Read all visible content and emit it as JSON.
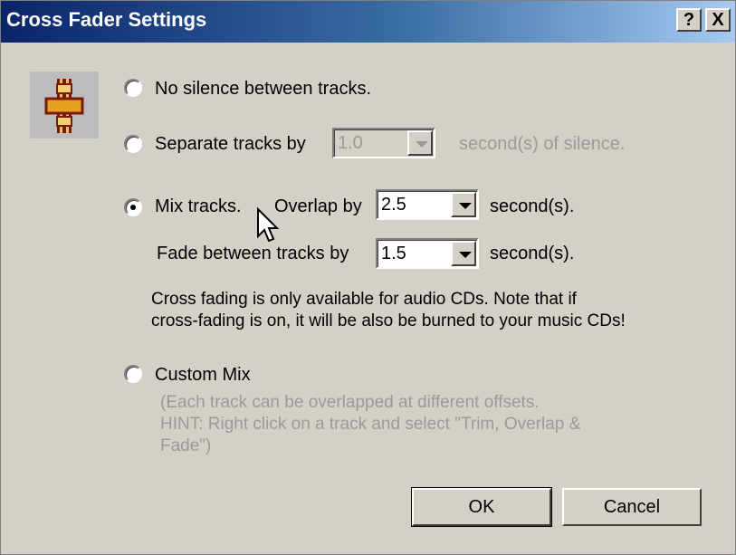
{
  "window": {
    "title": "Cross Fader Settings"
  },
  "titlebar_buttons": {
    "help": "?",
    "close": "X"
  },
  "options": {
    "no_silence": {
      "label": "No silence between tracks.",
      "selected": false
    },
    "separate": {
      "label": "Separate tracks by",
      "value": "1.0",
      "suffix": "second(s) of silence.",
      "selected": false,
      "enabled": false
    },
    "mix": {
      "label": "Mix tracks.",
      "overlap_label": "Overlap by",
      "overlap_value": "2.5",
      "overlap_suffix": "second(s).",
      "fade_label": "Fade between tracks by",
      "fade_value": "1.5",
      "fade_suffix": "second(s).",
      "selected": true
    },
    "custom": {
      "label": "Custom Mix",
      "selected": false
    }
  },
  "notes": {
    "crossfade_line1": "Cross fading is only available for audio CDs.  Note that if",
    "crossfade_line2": "cross-fading is on, it will be also be burned to your music CDs!",
    "hint_line1": "(Each track can be overlapped at different offsets.",
    "hint_line2": "HINT: Right click on a track and select \"Trim, Overlap &",
    "hint_line3": "Fade\")"
  },
  "buttons": {
    "ok": "OK",
    "cancel": "Cancel"
  },
  "colors": {
    "face": "#d4d0c8",
    "title_start": "#0a246a",
    "title_end": "#a6caf0",
    "disabled_text": "#9a9a9a"
  }
}
